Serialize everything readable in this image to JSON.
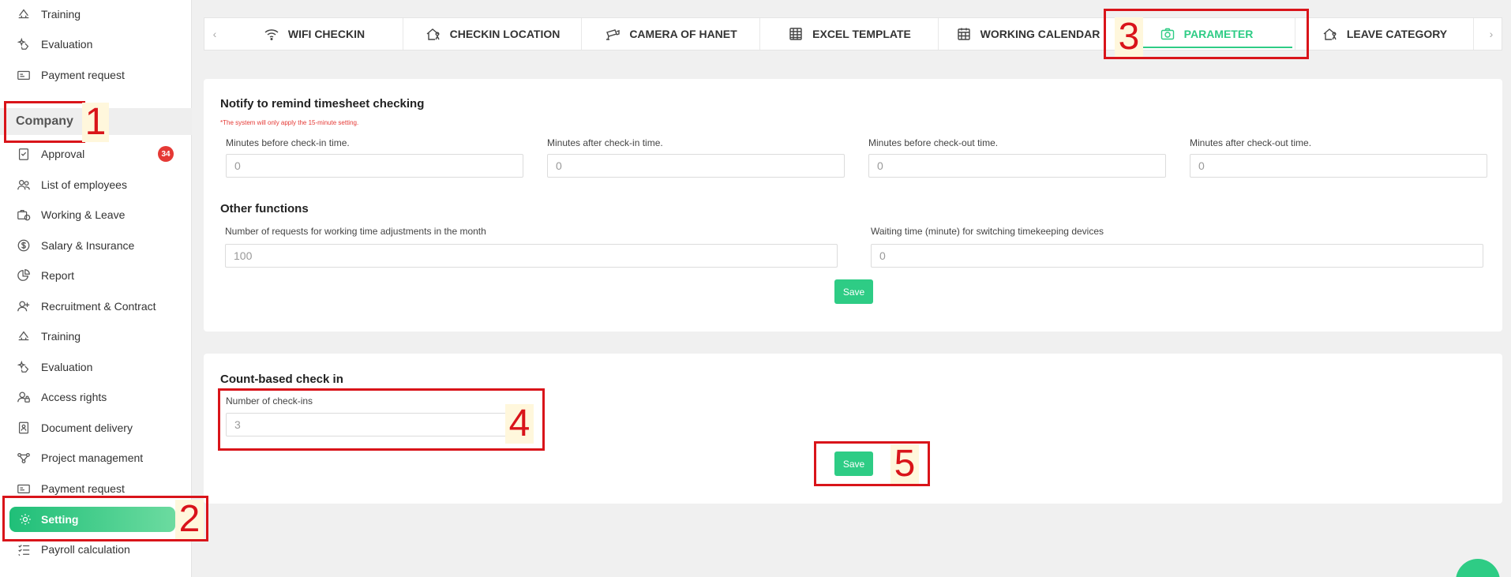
{
  "sidebar": {
    "top_items": [
      {
        "label": "Training",
        "icon": "training-icon"
      },
      {
        "label": "Evaluation",
        "icon": "evaluation-icon"
      },
      {
        "label": "Payment request",
        "icon": "payment-icon"
      }
    ],
    "section_label": "Company",
    "items": [
      {
        "label": "Approval",
        "icon": "approval-icon"
      },
      {
        "label": "List of employees",
        "icon": "employees-icon"
      },
      {
        "label": "Working & Leave",
        "icon": "working-leave-icon"
      },
      {
        "label": "Salary & Insurance",
        "icon": "salary-icon"
      },
      {
        "label": "Report",
        "icon": "report-icon"
      },
      {
        "label": "Recruitment & Contract",
        "icon": "recruitment-icon"
      },
      {
        "label": "Training",
        "icon": "training-icon"
      },
      {
        "label": "Evaluation",
        "icon": "evaluation-icon"
      },
      {
        "label": "Access rights",
        "icon": "access-rights-icon"
      },
      {
        "label": "Document delivery",
        "icon": "document-icon"
      },
      {
        "label": "Project management",
        "icon": "project-icon"
      },
      {
        "label": "Payment request",
        "icon": "payment-icon"
      },
      {
        "label": "Setting",
        "icon": "gear-icon"
      },
      {
        "label": "Payroll calculation",
        "icon": "payroll-icon"
      }
    ],
    "approval_badge": "34"
  },
  "tabs": [
    {
      "label": "WIFI CHECKIN",
      "icon": "wifi-icon"
    },
    {
      "label": "CHECKIN LOCATION",
      "icon": "location-icon"
    },
    {
      "label": "CAMERA OF HANET",
      "icon": "camera-icon"
    },
    {
      "label": "EXCEL TEMPLATE",
      "icon": "spreadsheet-icon"
    },
    {
      "label": "WORKING CALENDAR",
      "icon": "calendar-icon"
    },
    {
      "label": "PARAMETER",
      "icon": "camera-icon"
    },
    {
      "label": "LEAVE CATEGORY",
      "icon": "leave-icon"
    }
  ],
  "active_tab": "PARAMETER",
  "remind": {
    "title": "Notify to remind timesheet checking",
    "note": "*The system will only apply the 15-minute setting.",
    "fields": [
      {
        "label": "Minutes before check-in time.",
        "value": "0"
      },
      {
        "label": "Minutes after check-in time.",
        "value": "0"
      },
      {
        "label": "Minutes before check-out time.",
        "value": "0"
      },
      {
        "label": "Minutes after check-out time.",
        "value": "0"
      }
    ]
  },
  "other": {
    "title": "Other functions",
    "fields": [
      {
        "label": "Number of requests for working time adjustments in the month",
        "value": "100"
      },
      {
        "label": "Waiting time (minute) for switching timekeeping devices",
        "value": "0"
      }
    ],
    "save_label": "Save"
  },
  "count_based": {
    "title": "Count-based check in",
    "field_label": "Number of check-ins",
    "field_value": "3",
    "save_label": "Save"
  },
  "annotations": [
    "1",
    "2",
    "3",
    "4",
    "5"
  ],
  "colors": {
    "accent": "#2ecc85",
    "annotation": "#d9141a",
    "badge": "#e53935"
  }
}
